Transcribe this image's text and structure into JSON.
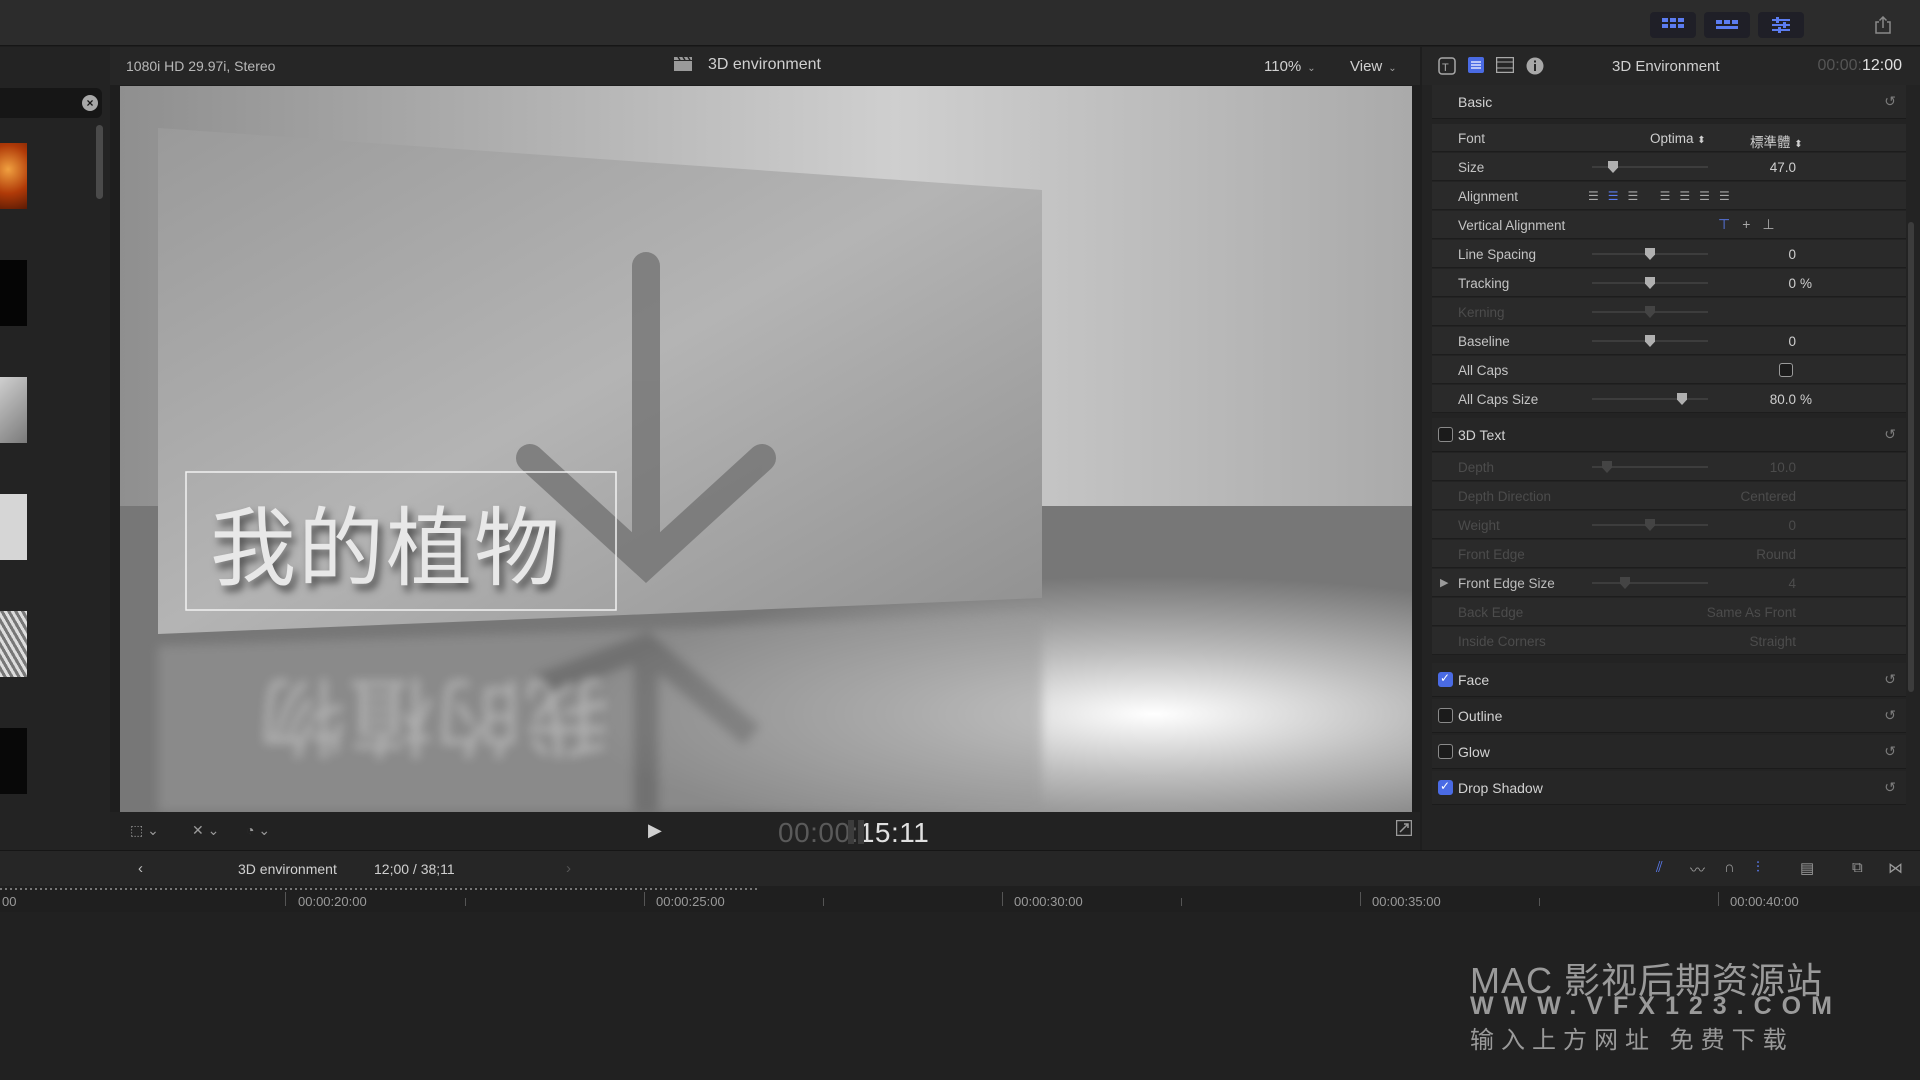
{
  "viewer": {
    "format": "1080i HD 29.97i, Stereo",
    "title": "3D environment",
    "zoom": "110%",
    "view_label": "View",
    "timecode_dim": "00:00:",
    "timecode": "15:11"
  },
  "canvas": {
    "title_text": "我的植物"
  },
  "inspector": {
    "title": "3D Environment",
    "time_dim": "00:00:",
    "time": "12:00",
    "basic": {
      "label": "Basic"
    },
    "rows": {
      "font": {
        "label": "Font",
        "family": "Optima",
        "style": "標準體"
      },
      "size": {
        "label": "Size",
        "value": "47.0"
      },
      "alignment": {
        "label": "Alignment"
      },
      "vertical_alignment": {
        "label": "Vertical Alignment"
      },
      "line_spacing": {
        "label": "Line Spacing",
        "value": "0"
      },
      "tracking": {
        "label": "Tracking",
        "value": "0",
        "unit": "%"
      },
      "kerning": {
        "label": "Kerning"
      },
      "baseline": {
        "label": "Baseline",
        "value": "0"
      },
      "all_caps": {
        "label": "All Caps"
      },
      "all_caps_size": {
        "label": "All Caps Size",
        "value": "80.0",
        "unit": "%"
      }
    },
    "text3d": {
      "label": "3D Text",
      "depth": {
        "label": "Depth",
        "value": "10.0"
      },
      "depth_direction": {
        "label": "Depth Direction",
        "value": "Centered"
      },
      "weight": {
        "label": "Weight",
        "value": "0"
      },
      "front_edge": {
        "label": "Front Edge",
        "value": "Round"
      },
      "front_edge_size": {
        "label": "Front Edge Size",
        "value": "4"
      },
      "back_edge": {
        "label": "Back Edge",
        "value": "Same As Front"
      },
      "inside_corners": {
        "label": "Inside Corners",
        "value": "Straight"
      }
    },
    "sections": {
      "face": {
        "label": "Face",
        "checked": true
      },
      "outline": {
        "label": "Outline",
        "checked": false
      },
      "glow": {
        "label": "Glow",
        "checked": false
      },
      "drop_shadow": {
        "label": "Drop Shadow",
        "checked": true
      }
    }
  },
  "timeline": {
    "project": "3D environment",
    "duration": "12;00 / 38;11",
    "ticks": [
      "00:00:20:00",
      "00:00:25:00",
      "00:00:30:00",
      "00:00:35:00",
      "00:00:40:00"
    ],
    "left_fragment": "00"
  },
  "watermark": {
    "line1": "MAC 影视后期资源站",
    "line2": "WWW.VFX123.COM",
    "line3": "输入上方网址 免费下载"
  },
  "colors": {
    "accent": "#4a6be4",
    "panel": "#232323"
  }
}
